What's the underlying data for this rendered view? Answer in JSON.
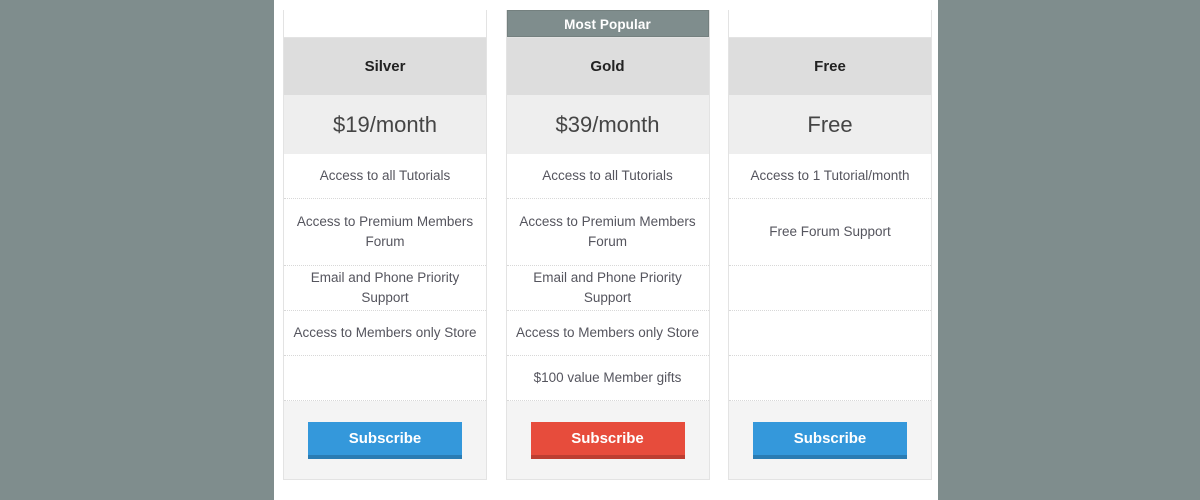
{
  "theme": {
    "page_background": "#7f8d8d",
    "panel_background": "#ffffff",
    "title_row_background": "#dddddd",
    "price_row_background": "#eeeeee",
    "footer_background": "#f4f4f4",
    "ribbon_background": "#7f8d8d",
    "button_primary": "#3498db",
    "button_featured": "#e74c3c",
    "row_divider": "#d8d8d8"
  },
  "pricing_table": {
    "featured_badge_label": "Most Popular",
    "plans": [
      {
        "id": "silver",
        "name": "Silver",
        "price": "$19/month",
        "featured": false,
        "badge": null,
        "features": [
          {
            "text": "Access to all Tutorials",
            "tall": false,
            "empty": false
          },
          {
            "text": "Access to Premium Members Forum",
            "tall": true,
            "empty": false
          },
          {
            "text": "Email and Phone Priority Support",
            "tall": false,
            "empty": false
          },
          {
            "text": "Access to Members only Store",
            "tall": false,
            "empty": false
          },
          {
            "text": "",
            "tall": false,
            "empty": true
          }
        ],
        "cta": {
          "label": "Subscribe",
          "style": "blue"
        }
      },
      {
        "id": "gold",
        "name": "Gold",
        "price": "$39/month",
        "featured": true,
        "badge": "Most Popular",
        "features": [
          {
            "text": "Access to all Tutorials",
            "tall": false,
            "empty": false
          },
          {
            "text": "Access to Premium Members Forum",
            "tall": true,
            "empty": false
          },
          {
            "text": "Email and Phone Priority Support",
            "tall": false,
            "empty": false
          },
          {
            "text": "Access to Members only Store",
            "tall": false,
            "empty": false
          },
          {
            "text": "$100 value Member gifts",
            "tall": false,
            "empty": false
          }
        ],
        "cta": {
          "label": "Subscribe",
          "style": "red"
        }
      },
      {
        "id": "free",
        "name": "Free",
        "price": "Free",
        "featured": false,
        "badge": null,
        "features": [
          {
            "text": "Access to 1 Tutorial/month",
            "tall": false,
            "empty": false
          },
          {
            "text": "Free Forum Support",
            "tall": true,
            "empty": false
          },
          {
            "text": "",
            "tall": false,
            "empty": true
          },
          {
            "text": "",
            "tall": false,
            "empty": true
          },
          {
            "text": "",
            "tall": false,
            "empty": true
          }
        ],
        "cta": {
          "label": "Subscribe",
          "style": "blue"
        }
      }
    ]
  }
}
